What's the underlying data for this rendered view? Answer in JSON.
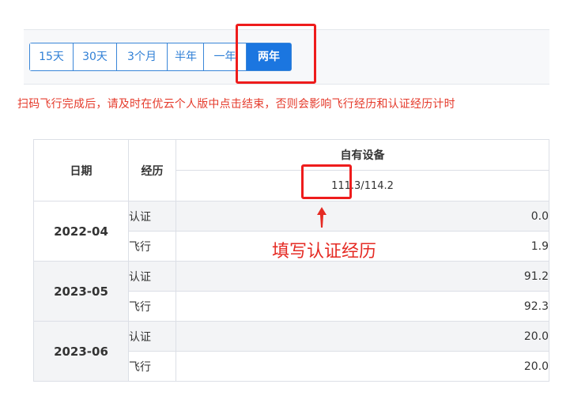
{
  "range_tabs": [
    {
      "label": "15天",
      "active": false
    },
    {
      "label": "30天",
      "active": false
    },
    {
      "label": "3个月",
      "active": false
    },
    {
      "label": "半年",
      "active": false
    },
    {
      "label": "一年",
      "active": false
    },
    {
      "label": "两年",
      "active": true
    }
  ],
  "notice": "扫码飞行完成后，请及时在优云个人版中点击结束，否则会影响飞行经历和认证经历计时",
  "table": {
    "headers": {
      "date": "日期",
      "experience": "经历",
      "device": "自有设备"
    },
    "device_sub": "111.3/114.2",
    "rows": [
      {
        "date": "2022-04",
        "cert_label": "认证",
        "cert_value": "0.0",
        "flight_label": "飞行",
        "flight_value": "1.9"
      },
      {
        "date": "2023-05",
        "cert_label": "认证",
        "cert_value": "91.2",
        "flight_label": "飞行",
        "flight_value": "92.3"
      },
      {
        "date": "2023-06",
        "cert_label": "认证",
        "cert_value": "20.0",
        "flight_label": "飞行",
        "flight_value": "20.0"
      }
    ]
  },
  "annotation": "填写认证经历",
  "colors": {
    "accent": "#1b76e0",
    "warning": "#e53b2c",
    "highlight_box": "#ee1c1c"
  }
}
